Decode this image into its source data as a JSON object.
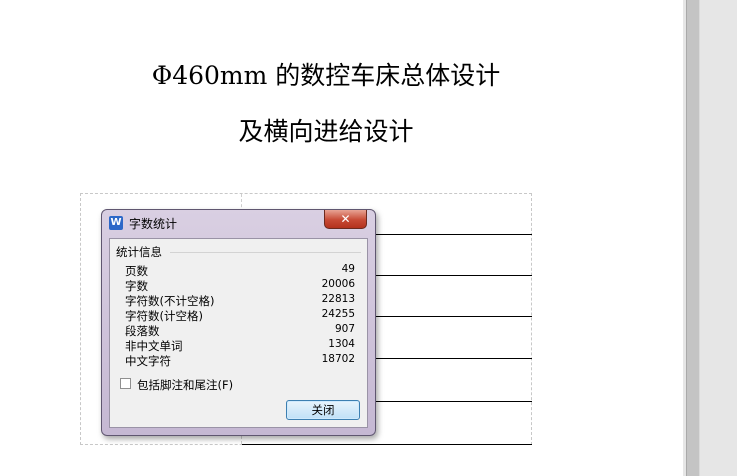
{
  "document": {
    "title_line1": "Φ460mm 的数控车床总体设计",
    "title_line2": "及横向进给设计"
  },
  "dialog": {
    "title": "字数统计",
    "app_icon_letter": "W",
    "close_label": "✕",
    "group_label": "统计信息",
    "stats": [
      {
        "label": "页数",
        "value": "49"
      },
      {
        "label": "字数",
        "value": "20006"
      },
      {
        "label": "字符数(不计空格)",
        "value": "22813"
      },
      {
        "label": "字符数(计空格)",
        "value": "24255"
      },
      {
        "label": "段落数",
        "value": "907"
      },
      {
        "label": "非中文单词",
        "value": "1304"
      },
      {
        "label": "中文字符",
        "value": "18702"
      }
    ],
    "checkbox_label": "包括脚注和尾注(F)",
    "checkbox_checked": false,
    "close_button_label": "关闭"
  },
  "colors": {
    "dialog_frame": "#c9bdd6",
    "close_button": "#c74a35",
    "ok_button_border": "#3c7fb1"
  }
}
